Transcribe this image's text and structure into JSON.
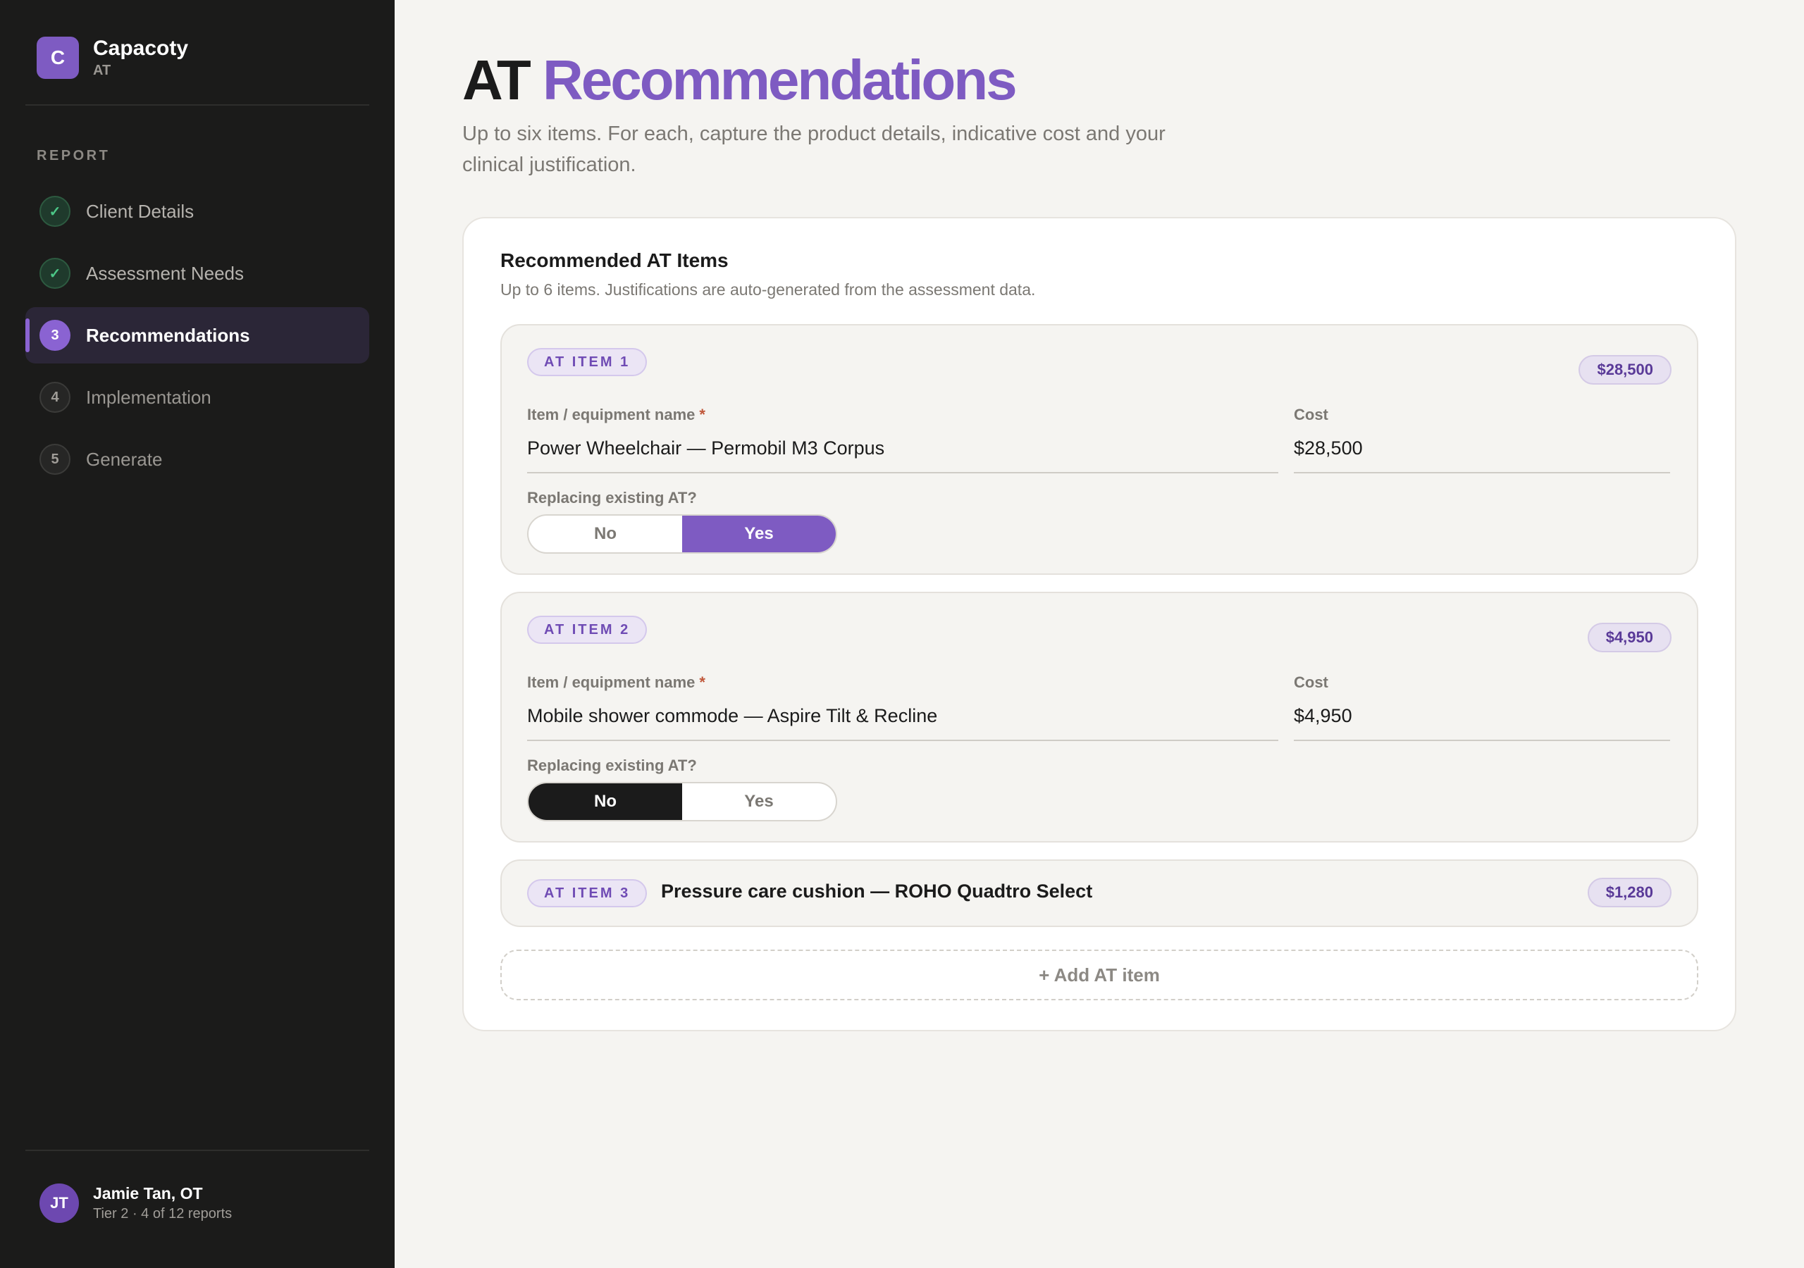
{
  "brand": {
    "logo_letter": "C",
    "name": "Capacoty",
    "sub": "AT"
  },
  "sidebar": {
    "section_label": "REPORT",
    "items": [
      {
        "label": "Client Details",
        "state": "done",
        "marker": "✓"
      },
      {
        "label": "Assessment Needs",
        "state": "done",
        "marker": "✓"
      },
      {
        "label": "Recommendations",
        "state": "current",
        "marker": "3"
      },
      {
        "label": "Implementation",
        "state": "todo",
        "marker": "4"
      },
      {
        "label": "Generate",
        "state": "todo",
        "marker": "5"
      }
    ]
  },
  "user": {
    "initials": "JT",
    "name": "Jamie Tan, OT",
    "meta": "Tier 2 · 4 of 12 reports"
  },
  "page": {
    "title_prefix": "AT",
    "title_accent": "Recommendations",
    "subtitle": "Up to six items. For each, capture the product details, indicative cost and your clinical justification."
  },
  "card": {
    "title": "Recommended AT Items",
    "description": "Up to 6 items. Justifications are auto-generated from the assessment data."
  },
  "labels": {
    "item_name": "Item / equipment name",
    "required_mark": "*",
    "cost": "Cost",
    "replacing": "Replacing existing AT?",
    "no": "No",
    "yes": "Yes"
  },
  "items": [
    {
      "tag": "AT ITEM 1",
      "cost_badge": "$28,500",
      "name": "Power Wheelchair — Permobil M3 Corpus",
      "cost": "$28,500",
      "replacing": "Yes"
    },
    {
      "tag": "AT ITEM 2",
      "cost_badge": "$4,950",
      "name": "Mobile shower commode — Aspire Tilt & Recline",
      "cost": "$4,950",
      "replacing": "No"
    },
    {
      "tag": "AT ITEM 3",
      "cost_badge": "$1,280",
      "name": "Pressure care cushion — ROHO Quadtro Select"
    }
  ],
  "add_button": "+ Add AT item",
  "colors": {
    "accent": "#7e5bc2",
    "sidebar_bg": "#1b1b1a",
    "page_bg": "#f5f4f1",
    "done_green": "#4cc787"
  }
}
